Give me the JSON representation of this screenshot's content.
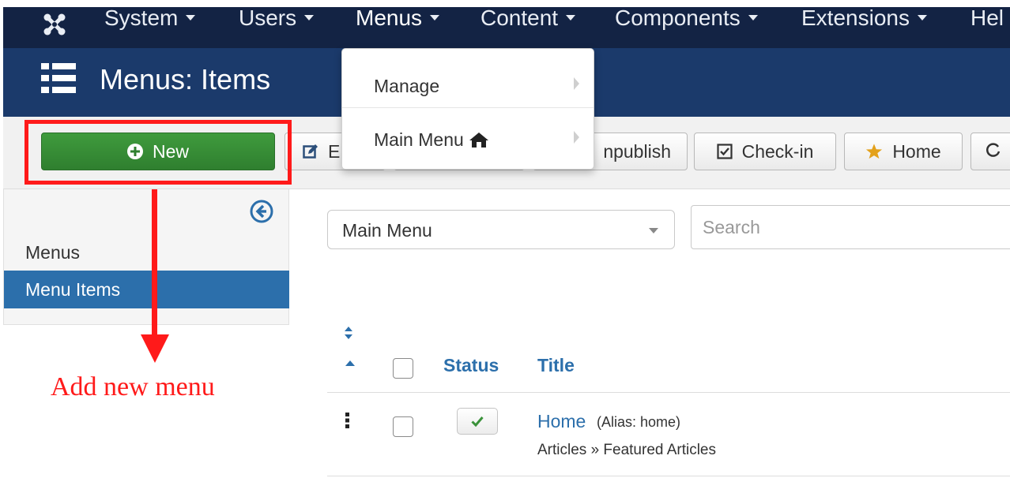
{
  "nav": {
    "items": [
      {
        "label": "System"
      },
      {
        "label": "Users"
      },
      {
        "label": "Menus"
      },
      {
        "label": "Content"
      },
      {
        "label": "Components"
      },
      {
        "label": "Extensions"
      },
      {
        "label": "Hel"
      }
    ],
    "logo_icon": "joomla-logo-icon"
  },
  "header": {
    "title": "Menus: Items",
    "icon": "list-icon"
  },
  "toolbar": {
    "new_label": "New",
    "edit_label": "E",
    "unpublish_label": "npublish",
    "checkin_label": "Check-in",
    "home_label": "Home",
    "new_icon": "plus-circle-icon",
    "edit_icon": "edit-icon",
    "checkin_icon": "checkbox-icon",
    "home_icon": "star-icon"
  },
  "dropdown": {
    "items": [
      {
        "label": "Manage"
      },
      {
        "label": "Main Menu",
        "icon": "home-icon"
      }
    ]
  },
  "sidebar": {
    "items": [
      {
        "label": "Menus"
      },
      {
        "label": "Menu Items"
      }
    ],
    "collapse_icon": "arrow-left-circle-icon"
  },
  "annotation": {
    "text": "Add new menu"
  },
  "filters": {
    "menu_select_value": "Main Menu",
    "search_placeholder": "Search"
  },
  "table": {
    "columns": [
      "Status",
      "Title"
    ],
    "rows": [
      {
        "title": "Home",
        "alias": "(Alias: home)",
        "type": "Articles » Featured Articles",
        "status": "published"
      }
    ]
  },
  "colors": {
    "navbar": "#132344",
    "header": "#1b3a6b",
    "new_button": "#3a923a",
    "link": "#2c6fab",
    "annotation": "#ff1a1a",
    "status_check": "#3a923a"
  }
}
